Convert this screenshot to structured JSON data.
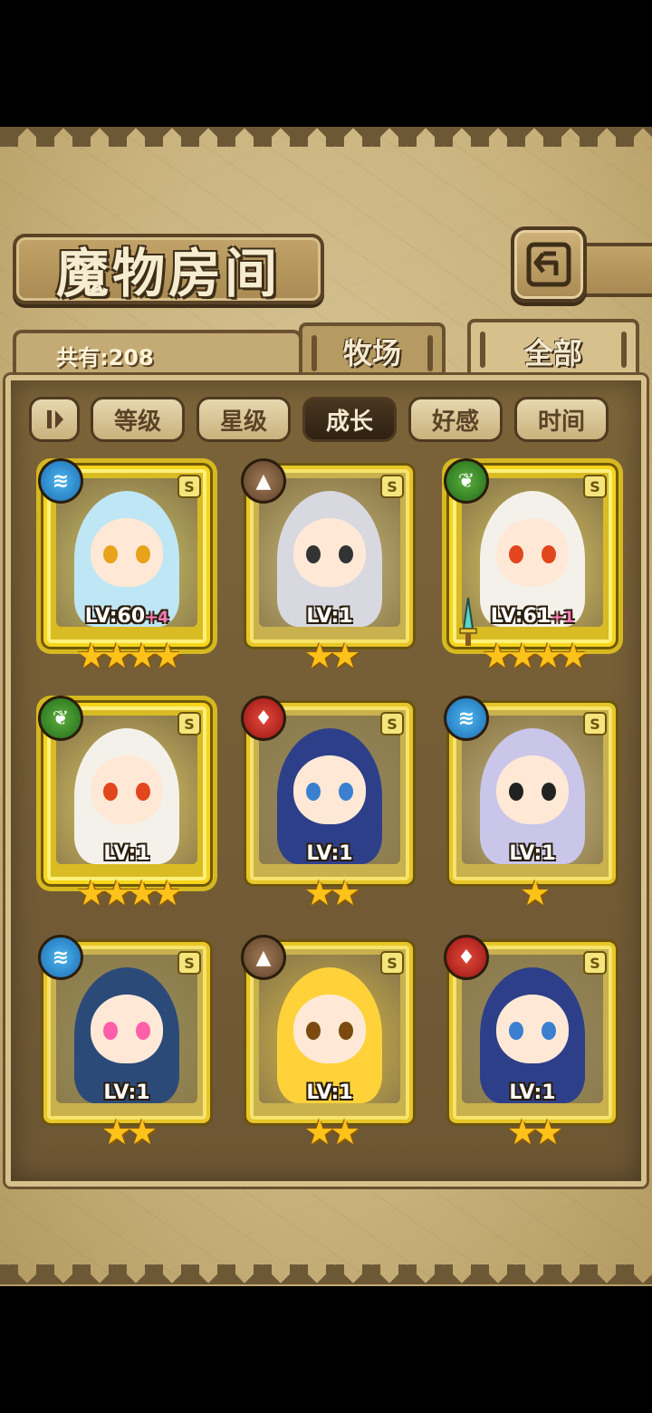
{
  "screen": {
    "title": "魔物房间",
    "back_icon": "return-arrow-icon",
    "count_label": "共有:208"
  },
  "tabs": [
    {
      "label": "牧场",
      "active": false
    },
    {
      "label": "全部",
      "active": true
    }
  ],
  "filters": {
    "toggle_icon": "pause-sort-icon",
    "buttons": [
      {
        "label": "等级",
        "active": false
      },
      {
        "label": "星级",
        "active": false
      },
      {
        "label": "成长",
        "active": true
      },
      {
        "label": "好感",
        "active": false
      },
      {
        "label": "时间",
        "active": false
      }
    ]
  },
  "cards": [
    {
      "element": "water",
      "element_icon": "water-wave-icon",
      "rank": "S",
      "level": "LV:60",
      "bonus": "+4",
      "stars": "★★★★",
      "star_count": 4,
      "frame": "gold",
      "palette": {
        "hair": "#bfe6f5",
        "eye": "#e8a21c"
      }
    },
    {
      "element": "earth",
      "element_icon": "mountain-icon",
      "rank": "S",
      "level": "LV:1",
      "bonus": "",
      "stars": "★★",
      "star_count": 2,
      "frame": "plain",
      "palette": {
        "hair": "#d8d8e0",
        "eye": "#333333"
      }
    },
    {
      "element": "wood",
      "element_icon": "leaf-icon",
      "rank": "S",
      "level": "LV:61",
      "bonus": "+1",
      "stars": "★★★★",
      "star_count": 4,
      "frame": "gold",
      "weapon": true,
      "palette": {
        "hair": "#f4f1ea",
        "eye": "#e2461c"
      }
    },
    {
      "element": "wood",
      "element_icon": "leaf-icon",
      "rank": "S",
      "level": "LV:1",
      "bonus": "",
      "stars": "★★★★",
      "star_count": 4,
      "frame": "gold",
      "palette": {
        "hair": "#f4f1ea",
        "eye": "#e2461c"
      }
    },
    {
      "element": "fire",
      "element_icon": "flame-icon",
      "rank": "S",
      "level": "LV:1",
      "bonus": "",
      "stars": "★★",
      "star_count": 2,
      "frame": "plain",
      "palette": {
        "hair": "#2e3f8a",
        "eye": "#3a7fd0"
      }
    },
    {
      "element": "water",
      "element_icon": "water-wave-icon",
      "rank": "S",
      "level": "LV:1",
      "bonus": "",
      "stars": "★",
      "star_count": 1,
      "frame": "plain",
      "palette": {
        "hair": "#c9c6ea",
        "eye": "#222222"
      }
    },
    {
      "element": "water",
      "element_icon": "water-wave-icon",
      "rank": "S",
      "level": "LV:1",
      "bonus": "",
      "stars": "★★",
      "star_count": 2,
      "frame": "plain",
      "palette": {
        "hair": "#2c4a78",
        "eye": "#ff5fa8"
      }
    },
    {
      "element": "earth",
      "element_icon": "mountain-icon",
      "rank": "S",
      "level": "LV:1",
      "bonus": "",
      "stars": "★★",
      "star_count": 2,
      "frame": "plain",
      "palette": {
        "hair": "#ffd23a",
        "eye": "#7a4a10"
      }
    },
    {
      "element": "fire",
      "element_icon": "flame-icon",
      "rank": "S",
      "level": "LV:1",
      "bonus": "",
      "stars": "★★",
      "star_count": 2,
      "frame": "plain",
      "palette": {
        "hair": "#2e3f8a",
        "eye": "#3a7fd0"
      }
    }
  ]
}
